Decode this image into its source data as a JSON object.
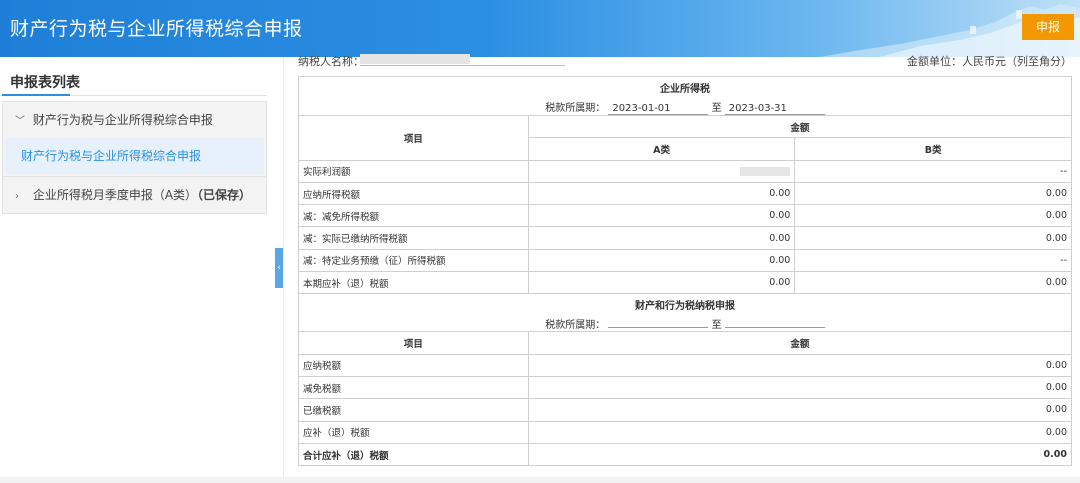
{
  "header": {
    "title": "财产行为税与企业所得税综合申报",
    "submit_label": "申报"
  },
  "sidebar": {
    "title": "申报表列表",
    "groups": [
      {
        "label": "财产行为税与企业所得税综合申报",
        "expanded": true,
        "items": [
          {
            "label": "财产行为税与企业所得税综合申报",
            "active": true
          }
        ]
      },
      {
        "label": "企业所得税月季度申报（A类）",
        "suffix": "（已保存）",
        "expanded": false
      }
    ]
  },
  "meta": {
    "taxpayer_label": "纳税人名称：",
    "unit_label": "金额单位：人民币元（列至角分）"
  },
  "cit": {
    "title": "企业所得税",
    "period_label": "税款所属期：",
    "period_from": "2023-01-01",
    "period_to_label": "至",
    "period_to": "2023-03-31",
    "col_item": "项目",
    "col_amount": "金额",
    "col_a": "A类",
    "col_b": "B类",
    "rows": [
      {
        "label": "实际利润额",
        "a": "",
        "b": "--"
      },
      {
        "label": "应纳所得税额",
        "a": "0.00",
        "b": "0.00"
      },
      {
        "label": "减：减免所得税额",
        "a": "0.00",
        "b": "0.00"
      },
      {
        "label": "减：实际已缴纳所得税额",
        "a": "0.00",
        "b": "0.00"
      },
      {
        "label": "减：特定业务预缴（征）所得税额",
        "a": "0.00",
        "b": "--"
      },
      {
        "label": "本期应补（退）税额",
        "a": "0.00",
        "b": "0.00"
      }
    ]
  },
  "ptax": {
    "title": "财产和行为税纳税申报",
    "period_label": "税款所属期：",
    "period_from": "",
    "period_to_label": "至",
    "period_to": "",
    "col_item": "项目",
    "col_amount": "金额",
    "rows": [
      {
        "label": "应纳税额",
        "v": "0.00"
      },
      {
        "label": "减免税额",
        "v": "0.00"
      },
      {
        "label": "已缴税额",
        "v": "0.00"
      },
      {
        "label": "应补（退）税额",
        "v": "0.00"
      }
    ],
    "total": {
      "label": "合计应补（退）税额",
      "v": "0.00"
    }
  },
  "colors": {
    "header_blue": "#2b8fe2",
    "submit_orange": "#f39800",
    "active_item_bg": "#e6f1fb"
  },
  "icons": {
    "expand": "chevron-down-icon",
    "collapse": "chevron-right-icon",
    "sidebar_toggle": "chevron-left-icon"
  }
}
